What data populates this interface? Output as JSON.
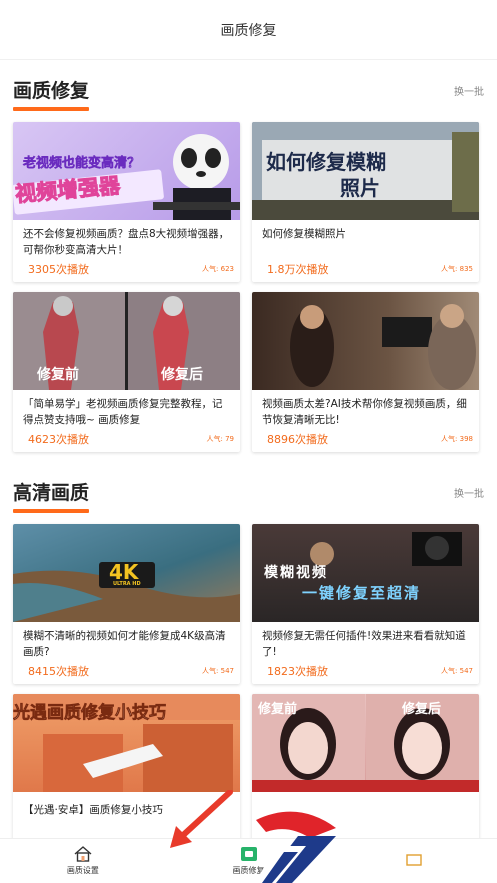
{
  "header": {
    "title": "画质修复"
  },
  "sections": [
    {
      "title": "画质修复",
      "more": "换一批",
      "cards": [
        {
          "title": "还不会修复视频画质？盘点8大视频增强器，可帮你秒变高清大片！",
          "plays": "3305次播放",
          "pop": "人气: 623",
          "overlay": "老视频也能变高清？",
          "overlay2": "视频增强器"
        },
        {
          "title": "如何修复模糊照片",
          "plays": "1.8万次播放",
          "pop": "人气: 835",
          "overlay": "如何修复模糊",
          "overlay2": "照片"
        },
        {
          "title": "「简单易学」老视频画质修复完整教程，记得点赞支持哦~ 画质修复",
          "plays": "4623次播放",
          "pop": "人气: 79",
          "overlay": "修复前",
          "overlay2": "修复后"
        },
        {
          "title": "视频画质太差?AI技术帮你修复视频画质，细节恢复清晰无比!",
          "plays": "8896次播放",
          "pop": "人气: 398"
        }
      ]
    },
    {
      "title": "高清画质",
      "more": "换一批",
      "cards": [
        {
          "title": "模糊不清晰的视频如何才能修复成4K级高清画质?",
          "plays": "8415次播放",
          "pop": "人气: 547",
          "overlay": "4K",
          "overlay2": "ULTRA HD"
        },
        {
          "title": "视频修复无需任何插件!效果进来看看就知道了!",
          "plays": "1823次播放",
          "pop": "人气: 547",
          "overlay": "模糊视频",
          "overlay2": "一键修复至超清"
        },
        {
          "title": "【光遇·安卓】画质修复小技巧",
          "overlay": "光遇画质修复小技巧"
        },
        {
          "title": "",
          "overlay": "修复前",
          "overlay2": "修复后"
        }
      ]
    }
  ],
  "tabs": [
    {
      "label": "画质设置",
      "icon": "home-icon"
    },
    {
      "label": "画质修复",
      "icon": "tv-icon"
    },
    {
      "label": "",
      "icon": "partial-icon"
    }
  ]
}
